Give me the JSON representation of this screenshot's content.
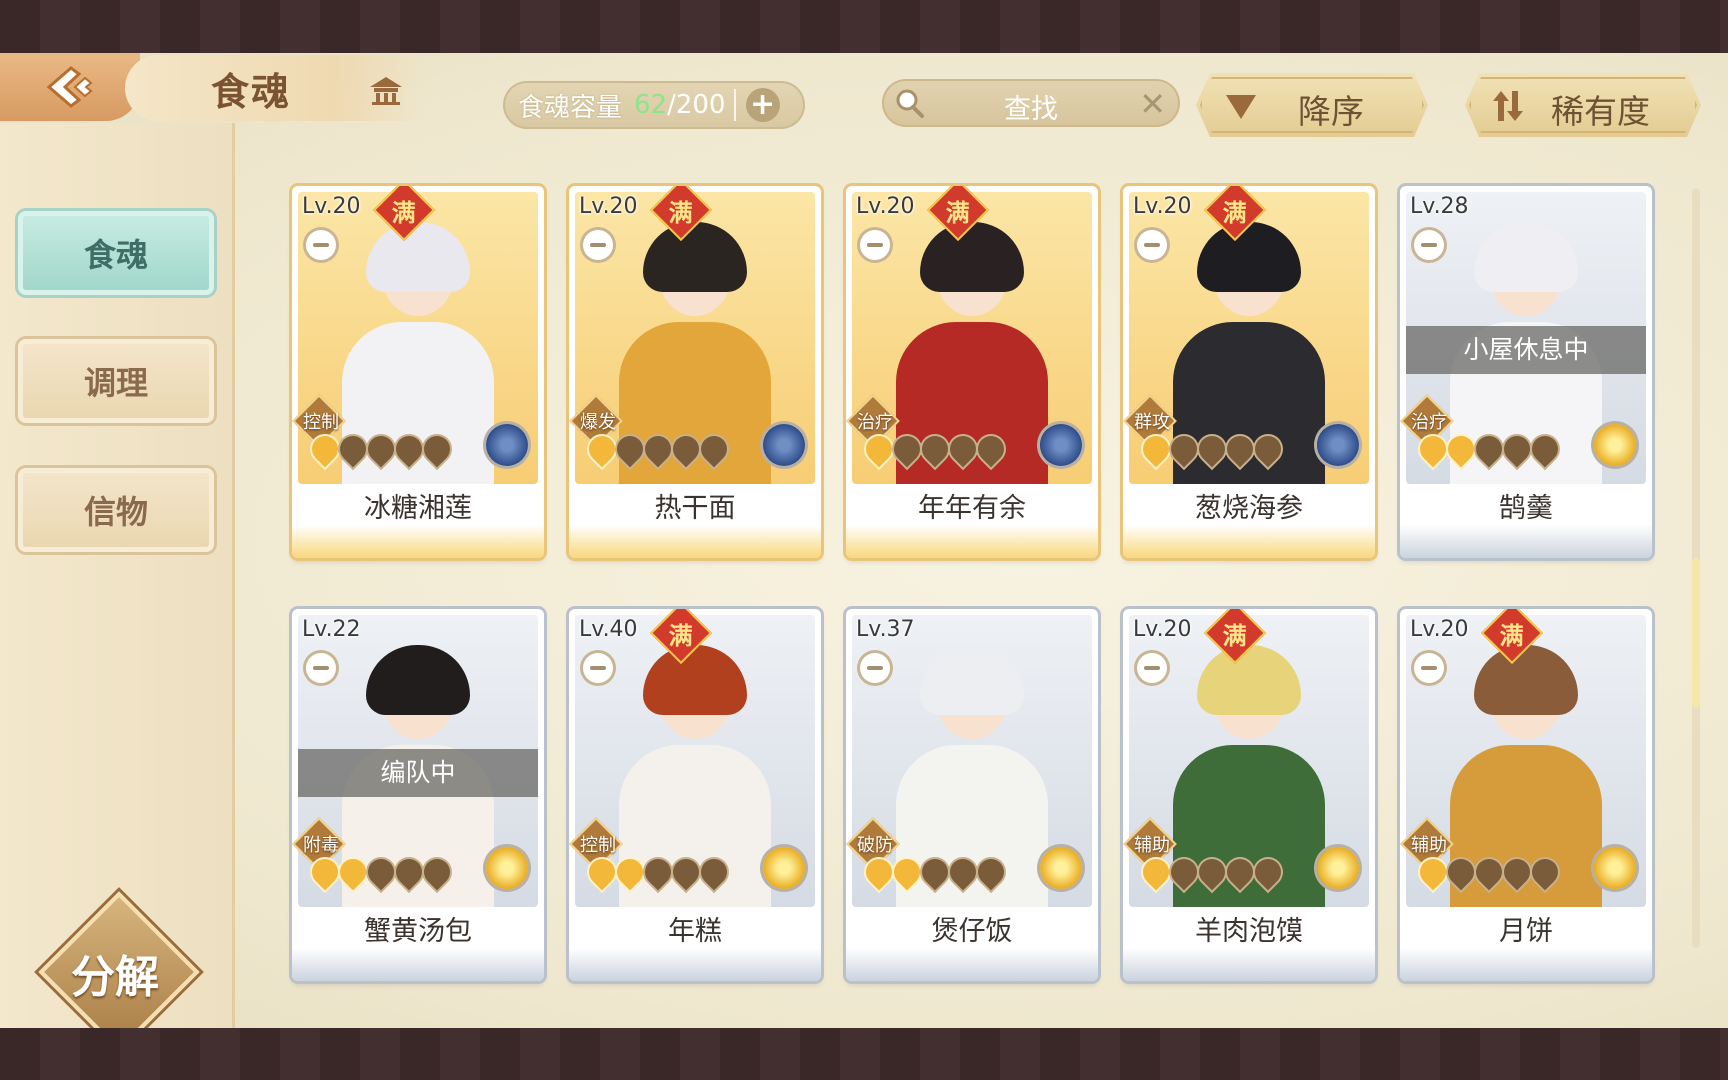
{
  "header": {
    "title": "食魂",
    "capacity_label": "食魂容量",
    "capacity_current": "62",
    "capacity_sep": "/",
    "capacity_max": "200",
    "search_placeholder": "查找",
    "sort_order_label": "降序",
    "sort_key_label": "稀有度"
  },
  "sidebar": {
    "tabs": [
      {
        "label": "食魂",
        "active": true
      },
      {
        "label": "调理",
        "active": false
      },
      {
        "label": "信物",
        "active": false
      }
    ],
    "decompose_label": "分解"
  },
  "cards": [
    {
      "level": "Lv.20",
      "full_mark": "满",
      "role": "控制",
      "name": "冰糖湘莲",
      "stars_on": 1,
      "stars_total": 5,
      "element": "blue",
      "frame": "gold",
      "status": ""
    },
    {
      "level": "Lv.20",
      "full_mark": "满",
      "role": "爆发",
      "name": "热干面",
      "stars_on": 1,
      "stars_total": 5,
      "element": "blue",
      "frame": "gold",
      "status": ""
    },
    {
      "level": "Lv.20",
      "full_mark": "满",
      "role": "治疗",
      "name": "年年有余",
      "stars_on": 1,
      "stars_total": 5,
      "element": "blue",
      "frame": "gold",
      "status": ""
    },
    {
      "level": "Lv.20",
      "full_mark": "满",
      "role": "群攻",
      "name": "葱烧海参",
      "stars_on": 1,
      "stars_total": 5,
      "element": "blue",
      "frame": "gold",
      "status": ""
    },
    {
      "level": "Lv.28",
      "full_mark": "",
      "role": "治疗",
      "name": "鹄羹",
      "stars_on": 2,
      "stars_total": 5,
      "element": "gold",
      "frame": "silver",
      "status": "小屋休息中"
    },
    {
      "level": "Lv.22",
      "full_mark": "",
      "role": "附毒",
      "name": "蟹黄汤包",
      "stars_on": 2,
      "stars_total": 5,
      "element": "gold",
      "frame": "silver",
      "status": "编队中"
    },
    {
      "level": "Lv.40",
      "full_mark": "满",
      "role": "控制",
      "name": "年糕",
      "stars_on": 2,
      "stars_total": 5,
      "element": "gold",
      "frame": "silver",
      "status": ""
    },
    {
      "level": "Lv.37",
      "full_mark": "",
      "role": "破防",
      "name": "煲仔饭",
      "stars_on": 2,
      "stars_total": 5,
      "element": "gold",
      "frame": "silver",
      "status": ""
    },
    {
      "level": "Lv.20",
      "full_mark": "满",
      "role": "辅助",
      "name": "羊肉泡馍",
      "stars_on": 1,
      "stars_total": 5,
      "element": "gold",
      "frame": "silver",
      "status": ""
    },
    {
      "level": "Lv.20",
      "full_mark": "满",
      "role": "辅助",
      "name": "月饼",
      "stars_on": 1,
      "stars_total": 5,
      "element": "gold",
      "frame": "silver",
      "status": ""
    }
  ]
}
